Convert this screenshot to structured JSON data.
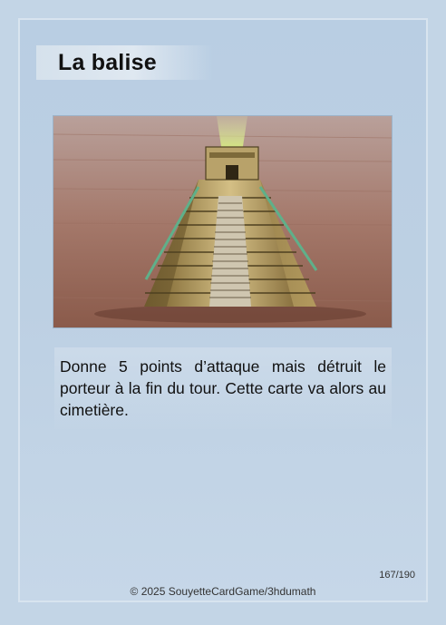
{
  "card": {
    "title": "La balise",
    "description": "Donne 5 points d’attaque mais détruit le porteur à la fin du tour. Cette carte va alors au cimetière.",
    "counter": "167/190",
    "copyright": "© 2025 SouyetteCardGame/3hdumath",
    "illustration": "stepped-pyramid-with-green-light-beam",
    "colors": {
      "frame": "#c3d5e6",
      "panel": "#bdd0e3",
      "text": "#111111"
    }
  }
}
